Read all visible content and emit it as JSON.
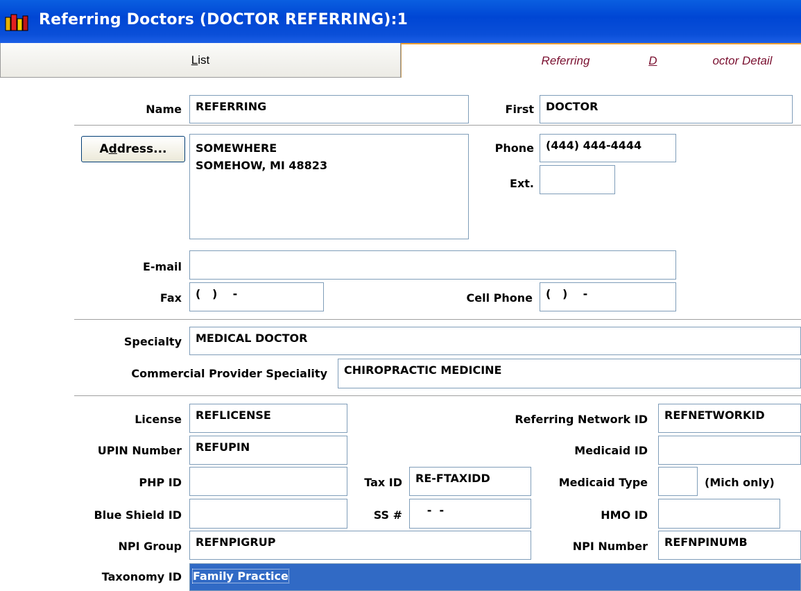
{
  "window": {
    "title": "Referring Doctors (DOCTOR REFERRING):1"
  },
  "tabs": {
    "list": {
      "prefix": "",
      "accel": "L",
      "rest": "ist"
    },
    "detail": {
      "prefix": "Referring ",
      "accel": "D",
      "rest": "octor Detail"
    }
  },
  "form": {
    "name_label": "Name",
    "name_value": "REFERRING",
    "first_label": "First",
    "first_value": "DOCTOR",
    "address_button": {
      "prefix": "A",
      "accel": "d",
      "rest": "dress..."
    },
    "address_value": "SOMEWHERE\nSOMEHOW, MI 48823",
    "phone_label": "Phone",
    "phone_value": "(444) 444-4444",
    "ext_label": "Ext.",
    "ext_value": "",
    "email_label": "E-mail",
    "email_value": "",
    "fax_label": "Fax",
    "fax_value": "(   )    -",
    "cell_label": "Cell Phone",
    "cell_value": "(   )    -",
    "specialty_label": "Specialty",
    "specialty_value": "MEDICAL DOCTOR",
    "commercial_label": "Commercial Provider Speciality",
    "commercial_value": "CHIROPRACTIC MEDICINE",
    "license_label": "License",
    "license_value": "REFLICENSE",
    "refnet_label": "Referring Network ID",
    "refnet_value": "REFNETWORKID",
    "upin_label": "UPIN Number",
    "upin_value": "REFUPIN",
    "medicaid_label": "Medicaid ID",
    "medicaid_value": "",
    "php_label": "PHP ID",
    "php_value": "",
    "taxid_label": "Tax ID",
    "taxid_value": "RE-FTAXIDD",
    "medtype_label": "Medicaid Type",
    "medtype_value": "",
    "mich_label": "(Mich only)",
    "blueshield_label": "Blue Shield ID",
    "blueshield_value": "",
    "ss_label": "SS #",
    "ss_value": "   -  -",
    "hmo_label": "HMO ID",
    "hmo_value": "",
    "npigroup_label": "NPI Group",
    "npigroup_value": "REFNPIGRUP",
    "npinumber_label": "NPI Number",
    "npinumber_value": "REFNPINUMB",
    "taxonomy_label": "Taxonomy ID",
    "taxonomy_value": "Family Practice"
  }
}
